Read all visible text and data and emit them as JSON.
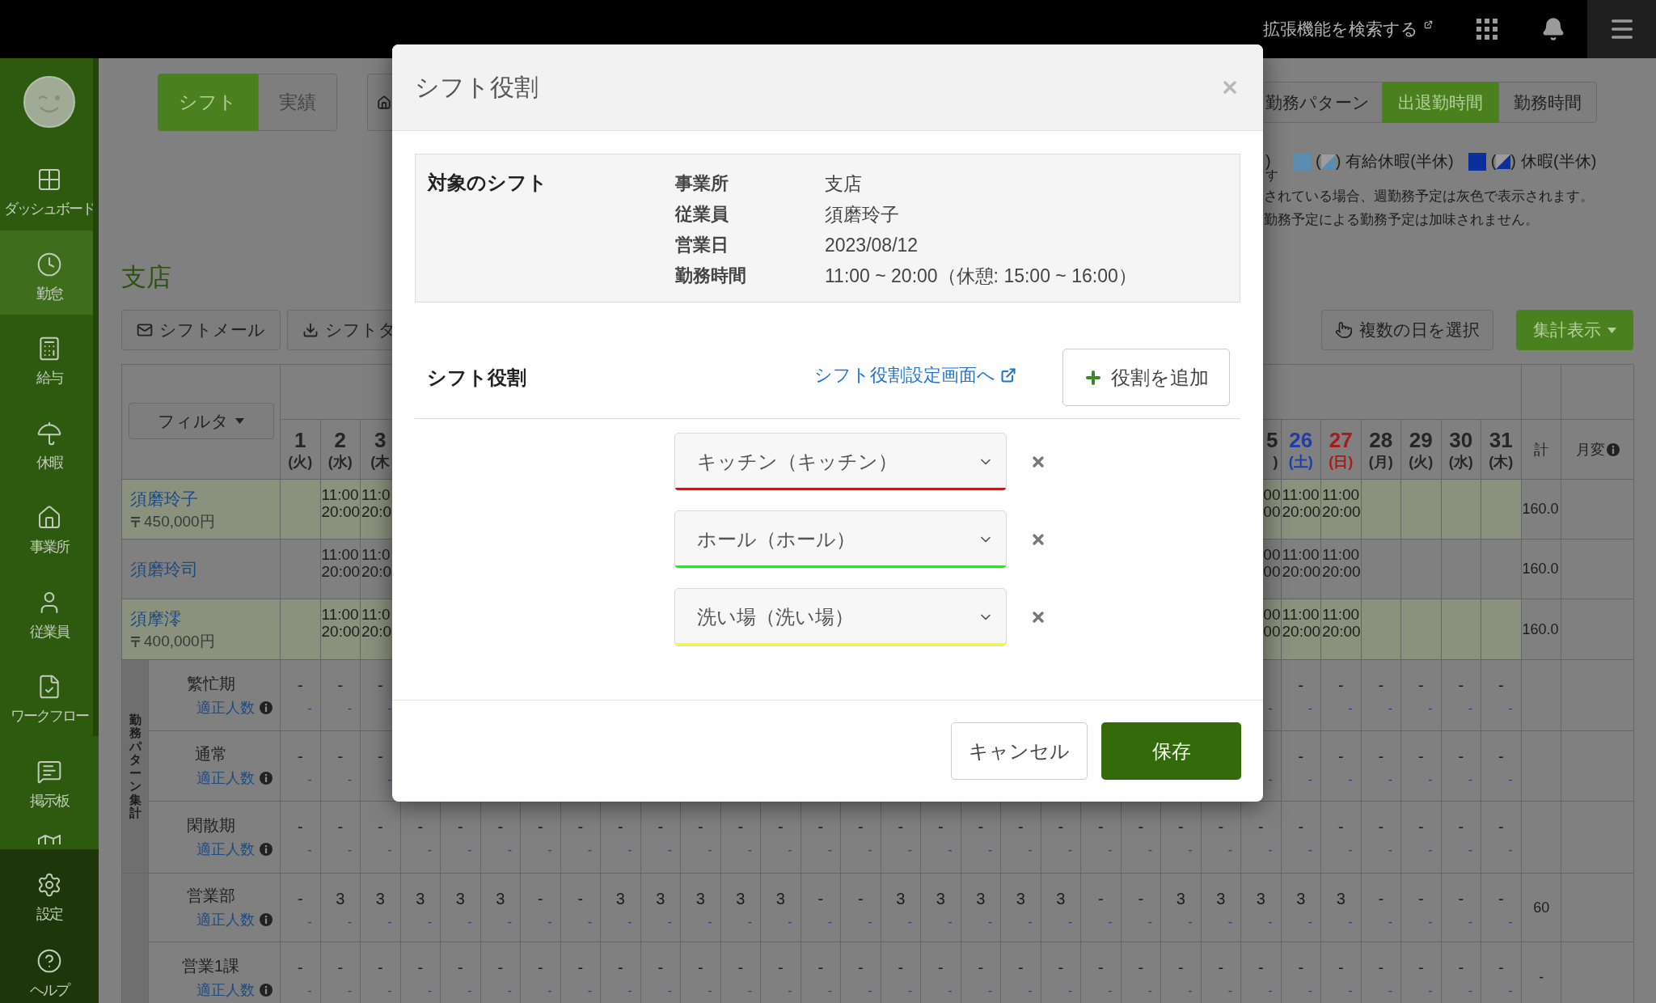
{
  "top_bar": {
    "extension_link": "拡張機能を検索する"
  },
  "sidebar": {
    "items": [
      {
        "label": "ダッシュボード",
        "selected": false
      },
      {
        "label": "勤怠",
        "selected": true
      },
      {
        "label": "給与",
        "selected": false
      },
      {
        "label": "休暇",
        "selected": false
      },
      {
        "label": "事業所",
        "selected": false
      },
      {
        "label": "従業員",
        "selected": false
      },
      {
        "label": "ワークフロー",
        "selected": false
      },
      {
        "label": "掲示板",
        "selected": false
      }
    ],
    "footer_items": [
      {
        "label": "設定"
      },
      {
        "label": "ヘルプ"
      }
    ]
  },
  "view_tabs": [
    {
      "label": "シフト",
      "selected": true
    },
    {
      "label": "実績",
      "selected": false
    }
  ],
  "office_title": "支店",
  "left_actions": [
    "シフトメール",
    "シフトダ"
  ],
  "display_tabs": [
    {
      "label": "勤務パターン",
      "selected": false
    },
    {
      "label": "出退勤時間",
      "selected": true
    },
    {
      "label": "勤務時間",
      "selected": false
    }
  ],
  "legend": {
    "clipped_texts": [
      ")",
      "す"
    ],
    "items": [
      {
        "open": "(",
        "close": ")",
        "label": "有給休暇(半休)",
        "color": "#5b8db3"
      },
      {
        "open": "(",
        "close": ")",
        "label": "休暇(半休)",
        "color": "#0b2f9c"
      }
    ]
  },
  "notes": [
    "されている場合、週勤務予定は灰色で表示されます。",
    "勤務予定による勤務予定は加味されません。"
  ],
  "right_actions": [
    "複数の日を選択",
    "集計表示"
  ],
  "table": {
    "filter_button": "フィルタ",
    "day_headers_left": [
      {
        "number": "1",
        "weekday": "(火)",
        "color": "#262626"
      },
      {
        "number": "2",
        "weekday": "(水)",
        "color": "#262626"
      },
      {
        "number": "3",
        "weekday": "(木",
        "color": "#262626"
      }
    ],
    "day_headers_right": [
      {
        "number": "5",
        "weekday": ")",
        "color": "#262626"
      },
      {
        "number": "26",
        "weekday": "(土)",
        "color": "#1c3ea6"
      },
      {
        "number": "27",
        "weekday": "(日)",
        "color": "#a61c1c"
      },
      {
        "number": "28",
        "weekday": "(月)",
        "color": "#262626"
      },
      {
        "number": "29",
        "weekday": "(火)",
        "color": "#262626"
      },
      {
        "number": "30",
        "weekday": "(水)",
        "color": "#262626"
      },
      {
        "number": "31",
        "weekday": "(木)",
        "color": "#262626"
      }
    ],
    "total_header": "計",
    "change_header": "月変",
    "employees": [
      {
        "name": "須磨玲子",
        "salary": "450,000円",
        "highlighted": true,
        "days_left": [
          {
            "kind": "blank"
          },
          {
            "kind": "shift",
            "start": "11:00",
            "end": "20:00"
          },
          {
            "kind": "shift",
            "start": "11:0",
            "end": "20:0"
          }
        ],
        "days_right": [
          {
            "kind": "shift",
            "start": "00",
            "end": "00"
          },
          {
            "kind": "shift",
            "start": "11:00",
            "end": "20:00"
          },
          {
            "kind": "shift",
            "start": "11:00",
            "end": "20:00"
          },
          {
            "kind": "blank"
          },
          {
            "kind": "blank"
          },
          {
            "kind": "blank"
          },
          {
            "kind": "blank"
          }
        ],
        "total": "160.0"
      },
      {
        "name": "須磨玲司",
        "highlighted": false,
        "days_left": [
          {
            "kind": "blank"
          },
          {
            "kind": "shift",
            "start": "11:00",
            "end": "20:00"
          },
          {
            "kind": "shift",
            "start": "11:0",
            "end": "20:0"
          }
        ],
        "days_right": [
          {
            "kind": "shift",
            "start": "00",
            "end": "00"
          },
          {
            "kind": "shift",
            "start": "11:00",
            "end": "20:00"
          },
          {
            "kind": "shift",
            "start": "11:00",
            "end": "20:00"
          },
          {
            "kind": "blank"
          },
          {
            "kind": "blank"
          },
          {
            "kind": "blank"
          },
          {
            "kind": "blank"
          }
        ],
        "total": "160.0"
      },
      {
        "name": "須摩澪",
        "salary": "400,000円",
        "highlighted": true,
        "days_left": [
          {
            "kind": "blank"
          },
          {
            "kind": "shift",
            "start": "11:00",
            "end": "20:00"
          },
          {
            "kind": "shift",
            "start": "11:0",
            "end": "20:0"
          }
        ],
        "days_right": [
          {
            "kind": "shift",
            "start": "00",
            "end": "00"
          },
          {
            "kind": "shift",
            "start": "11:00",
            "end": "20:00"
          },
          {
            "kind": "shift",
            "start": "11:00",
            "end": "20:00"
          },
          {
            "kind": "blank"
          },
          {
            "kind": "blank"
          },
          {
            "kind": "blank"
          },
          {
            "kind": "blank"
          }
        ],
        "total": "160.0"
      }
    ],
    "summary_groups": [
      {
        "label": "勤務パターン集計",
        "rows": [
          {
            "label": "繁忙期",
            "staffing": "適正人数",
            "days_left": [
              {
                "value": "-",
                "target": "-"
              },
              {
                "value": "-",
                "target": "-"
              },
              {
                "value": "-",
                "target": "-"
              }
            ],
            "days_right": [
              {
                "target": "-"
              },
              {
                "value": "-",
                "target": "-"
              },
              {
                "value": "-",
                "target": "-"
              },
              {
                "value": "-",
                "target": "-"
              },
              {
                "value": "-",
                "target": "-"
              },
              {
                "value": "-",
                "target": "-"
              },
              {
                "value": "-",
                "target": "-"
              }
            ]
          },
          {
            "label": "通常",
            "staffing": "適正人数",
            "days_left": [
              {
                "value": "-",
                "target": "-"
              },
              {
                "value": "-",
                "target": "-"
              },
              {
                "value": "-",
                "target": "-"
              }
            ],
            "days_right": [
              {
                "target": "-"
              },
              {
                "value": "-",
                "target": "-"
              },
              {
                "value": "-",
                "target": "-"
              },
              {
                "value": "-",
                "target": "-"
              },
              {
                "value": "-",
                "target": "-"
              },
              {
                "value": "-",
                "target": "-"
              },
              {
                "value": "-",
                "target": "-"
              }
            ]
          },
          {
            "label": "閑散期",
            "staffing": "適正人数",
            "days": [
              {
                "value": "-",
                "target": "-"
              },
              {
                "value": "-",
                "target": "-"
              },
              {
                "value": "-",
                "target": "-"
              },
              {
                "value": "-",
                "target": "-"
              },
              {
                "value": "-",
                "target": "-"
              },
              {
                "value": "-",
                "target": "-"
              },
              {
                "value": "-",
                "target": "-"
              },
              {
                "value": "-",
                "target": "-"
              },
              {
                "value": "-",
                "target": "-"
              },
              {
                "value": "-",
                "target": "-"
              },
              {
                "value": "-",
                "target": "-"
              },
              {
                "value": "-",
                "target": "-"
              },
              {
                "value": "-",
                "target": "-"
              },
              {
                "value": "-",
                "target": "-"
              },
              {
                "value": "-",
                "target": "-"
              },
              {
                "value": "-",
                "target": "-"
              },
              {
                "value": "-",
                "target": "-"
              },
              {
                "value": "-",
                "target": "-"
              },
              {
                "value": "-",
                "target": "-"
              },
              {
                "value": "-",
                "target": "-"
              },
              {
                "value": "-",
                "target": "-"
              },
              {
                "value": "-",
                "target": "-"
              },
              {
                "value": "-",
                "target": "-"
              },
              {
                "value": "-",
                "target": "-"
              },
              {
                "value": "-",
                "target": "-"
              },
              {
                "value": "-",
                "target": "-"
              },
              {
                "value": "-",
                "target": "-"
              },
              {
                "value": "-",
                "target": "-"
              },
              {
                "value": "-",
                "target": "-"
              },
              {
                "value": "-",
                "target": "-"
              },
              {
                "value": "-",
                "target": "-"
              }
            ]
          }
        ]
      },
      {
        "rows": [
          {
            "label": "営業部",
            "staffing": "適正人数",
            "days": [
              {
                "value": "-",
                "target": "-"
              },
              {
                "value": "3",
                "target": "-"
              },
              {
                "value": "3",
                "target": "-"
              },
              {
                "value": "3",
                "target": "-"
              },
              {
                "value": "3",
                "target": "-"
              },
              {
                "value": "3",
                "target": "-"
              },
              {
                "value": "-",
                "target": "-"
              },
              {
                "value": "-",
                "target": "-"
              },
              {
                "value": "3",
                "target": "-"
              },
              {
                "value": "3",
                "target": "-"
              },
              {
                "value": "3",
                "target": "-"
              },
              {
                "value": "3",
                "target": "-"
              },
              {
                "value": "3",
                "target": "-"
              },
              {
                "value": "-",
                "target": "-"
              },
              {
                "value": "-",
                "target": "-"
              },
              {
                "value": "3",
                "target": "-"
              },
              {
                "value": "3",
                "target": "-"
              },
              {
                "value": "3",
                "target": "-"
              },
              {
                "value": "3",
                "target": "-"
              },
              {
                "value": "3",
                "target": "-"
              },
              {
                "value": "-",
                "target": "-"
              },
              {
                "value": "-",
                "target": "-"
              },
              {
                "value": "3",
                "target": "-"
              },
              {
                "value": "3",
                "target": "-"
              },
              {
                "value": "3",
                "target": "-"
              },
              {
                "value": "3",
                "target": "-"
              },
              {
                "value": "3",
                "target": "-"
              },
              {
                "value": "-",
                "target": "-"
              },
              {
                "value": "-",
                "target": "-"
              },
              {
                "value": "-",
                "target": "-"
              },
              {
                "value": "-",
                "target": "-"
              }
            ],
            "total": "60"
          },
          {
            "label": "営業1課",
            "staffing": "適正人数",
            "days": [
              {
                "value": "-",
                "target": "-"
              },
              {
                "value": "-",
                "target": "-"
              },
              {
                "value": "-",
                "target": "-"
              },
              {
                "value": "-",
                "target": "-"
              },
              {
                "value": "-",
                "target": "-"
              },
              {
                "value": "-",
                "target": "-"
              },
              {
                "value": "-",
                "target": "-"
              },
              {
                "value": "-",
                "target": "-"
              },
              {
                "value": "-",
                "target": "-"
              },
              {
                "value": "-",
                "target": "-"
              },
              {
                "value": "-",
                "target": "-"
              },
              {
                "value": "-",
                "target": "-"
              },
              {
                "value": "-",
                "target": "-"
              },
              {
                "value": "-",
                "target": "-"
              },
              {
                "value": "-",
                "target": "-"
              },
              {
                "value": "-",
                "target": "-"
              },
              {
                "value": "-",
                "target": "-"
              },
              {
                "value": "-",
                "target": "-"
              },
              {
                "value": "-",
                "target": "-"
              },
              {
                "value": "-",
                "target": "-"
              },
              {
                "value": "-",
                "target": "-"
              },
              {
                "value": "-",
                "target": "-"
              },
              {
                "value": "-",
                "target": "-"
              },
              {
                "value": "-",
                "target": "-"
              },
              {
                "value": "-",
                "target": "-"
              },
              {
                "value": "-",
                "target": "-"
              },
              {
                "value": "-",
                "target": "-"
              },
              {
                "value": "-",
                "target": "-"
              },
              {
                "value": "-",
                "target": "-"
              },
              {
                "value": "-",
                "target": "-"
              },
              {
                "value": "-",
                "target": "-"
              }
            ],
            "total": "-"
          }
        ]
      }
    ]
  },
  "dialog": {
    "title": "シフト役割",
    "target": {
      "heading": "対象のシフト",
      "fields": [
        {
          "label": "事業所",
          "value": "支店"
        },
        {
          "label": "従業員",
          "value": "須磨玲子"
        },
        {
          "label": "営業日",
          "value": "2023/08/12"
        },
        {
          "label": "勤務時間",
          "value": "11:00 ~ 20:00（休憩: 15:00 ~ 16:00）"
        }
      ]
    },
    "roles_section": {
      "title": "シフト役割",
      "settings_link": "シフト役割設定画面へ",
      "add_button": "役割を追加"
    },
    "roles": [
      {
        "value": "キッチン（キッチン）",
        "color": "#ff0000"
      },
      {
        "value": "ホール（ホール）",
        "color": "#00ff00"
      },
      {
        "value": "洗い場（洗い場）",
        "color": "#ffff00"
      }
    ],
    "buttons": {
      "cancel": "キャンセル",
      "save": "保存"
    }
  }
}
